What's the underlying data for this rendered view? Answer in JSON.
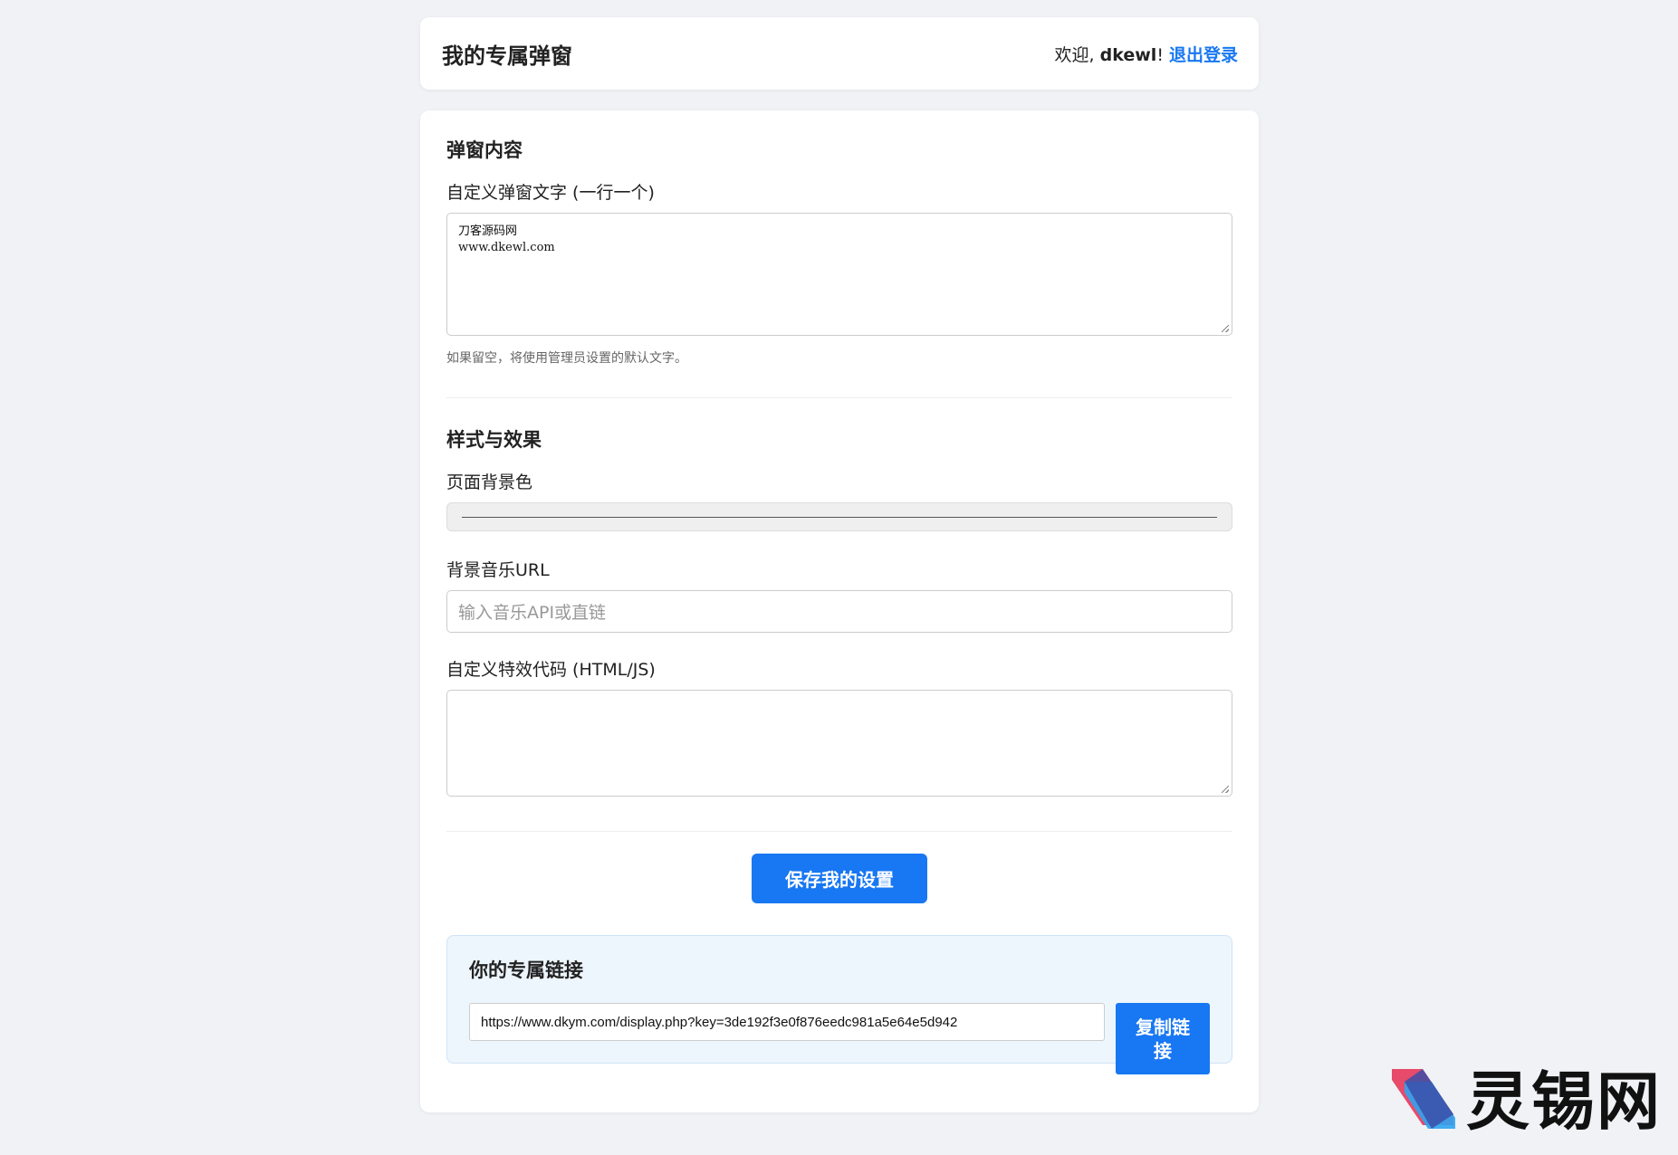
{
  "header": {
    "title": "我的专属弹窗",
    "welcome_prefix": "欢迎, ",
    "username": "dkewl",
    "exclaim": "! ",
    "logout": "退出登录"
  },
  "content_section": {
    "heading": "弹窗内容",
    "label": "自定义弹窗文字 (一行一个)",
    "value": "刀客源码网\nwww.dkewl.com",
    "hint": "如果留空，将使用管理员设置的默认文字。"
  },
  "style_section": {
    "heading": "样式与效果",
    "bg_color_label": "页面背景色",
    "music_label": "背景音乐URL",
    "music_placeholder": "输入音乐API或直链",
    "effect_label": "自定义特效代码 (HTML/JS)",
    "effect_value": ""
  },
  "save_button": "保存我的设置",
  "link_section": {
    "heading": "你的专属链接",
    "url": "https://www.dkym.com/display.php?key=3de192f3e0f876eedc981a5e64e5d942",
    "copy_button": "复制链接"
  },
  "watermark": {
    "text": "灵锡网"
  },
  "colors": {
    "accent": "#1877f2",
    "background": "#f0f2f5",
    "link_box_bg": "#eef6fd"
  }
}
